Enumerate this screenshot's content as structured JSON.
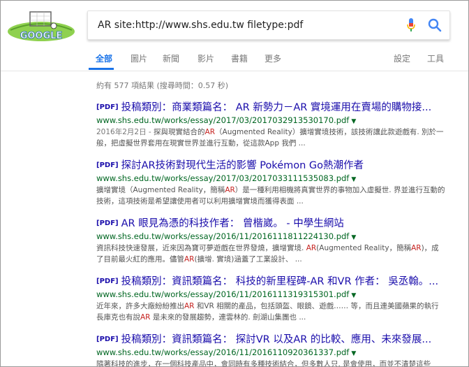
{
  "search": {
    "query": "AR site:http://www.shs.edu.tw filetype:pdf",
    "logo_text": "GOOGLE"
  },
  "tabs": [
    {
      "label": "全部",
      "active": true
    },
    {
      "label": "圖片"
    },
    {
      "label": "新聞"
    },
    {
      "label": "影片"
    },
    {
      "label": "書籍"
    },
    {
      "label": "更多"
    }
  ],
  "tools": {
    "settings": "設定",
    "tools": "工具"
  },
  "stats": "約有 577 項結果 (搜尋時間：0.57 秒)",
  "pdf_tag": "[PDF]",
  "results": [
    {
      "title": "投稿類別：商業類篇名： AR 新勢力－AR 實境運用在賣場的購物接...",
      "url": "www.shs.edu.tw/works/essay/2017/03/2017032913530170.pdf",
      "snippet": {
        "date": "2016年2月2日 - ",
        "parts": [
          "探與現實結合的",
          "AR",
          "（Augmented Reality）擴增實境技術，該技術讓此款遊戲有. 別於一般，把虛擬世界套用在現實世界並進行互動，從這款App 我們 ..."
        ]
      }
    },
    {
      "title": "探討AR技術對現代生活的影響 Pokémon Go熱潮作者",
      "url": "www.shs.edu.tw/works/essay/2017/03/2017033111535083.pdf",
      "snippet": {
        "parts": [
          "擴增實境（Augmented Reality，簡稱",
          "AR",
          "）是一種利用相機將真實世界的事物加入虛擬世. 界並進行互動的技術，這項技術是希望讓使用者可以利用擴增實境而獲得表面 ..."
        ]
      }
    },
    {
      "title": "AR 眼見為憑的科技作者： 曾楷崴。 - 中學生網站",
      "url": "www.shs.edu.tw/works/essay/2016/11/2016111811224130.pdf",
      "snippet": {
        "parts": [
          "資訊科技快速發展，近來因為寶可夢遊戲在世界發燒，擴增實境. ",
          "AR",
          "(Augmented Reality，簡稱",
          "AR",
          ")，成了目前最火紅的應用。儘管",
          "AR",
          "(擴增. 實境)涵蓋了工業設計、 ..."
        ]
      }
    },
    {
      "title": "投稿類別：資訊類篇名： 科技的新里程碑-AR 和VR 作者： 吳丞翰。...",
      "url": "www.shs.edu.tw/works/essay/2016/11/2016111319315301.pdf",
      "snippet": {
        "parts": [
          "近年來，許多大廠紛紛推出",
          "AR",
          " 和VR 相關的產品，包括頭盔、眼鏡、遊戲…… 等，而且連美國蘋果的執行長庫克也有說",
          "AR",
          " 是未來的發展趨勢，連雲林的. 劍湖山集團也 ..."
        ]
      }
    },
    {
      "title": "投稿類別：資訊類篇名： 探討VR 以及AR 的比較、應用、未來發展...",
      "url": "www.shs.edu.tw/works/essay/2016/11/2016110920361337.pdf",
      "snippet": {
        "parts": [
          "隨著科技的進步，在一個科技產品中，會同時有多種技術結合，但多數人只. 是會使用，而並不清楚這些"
        ]
      }
    }
  ],
  "colors": {
    "link": "#1a0dab",
    "url": "#006621",
    "accent": "#1a73e8",
    "highlight": "#c5221f"
  }
}
